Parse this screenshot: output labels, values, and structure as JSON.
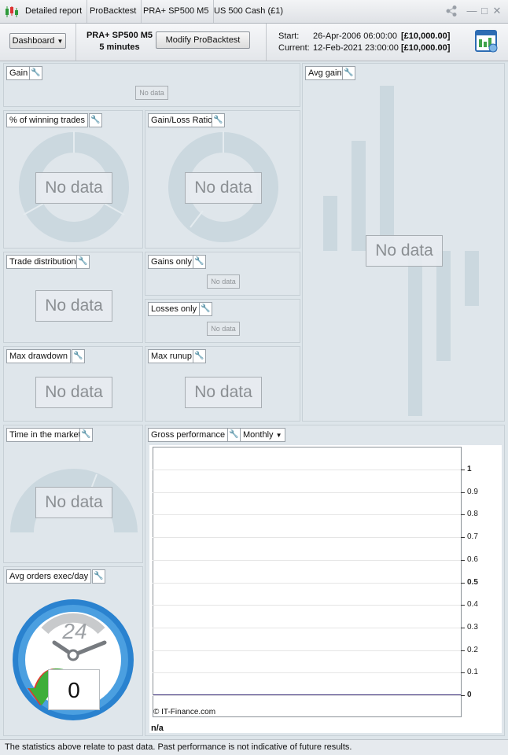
{
  "titlebar": {
    "tabs": [
      "Detailed report",
      "ProBacktest",
      "PRA+ SP500 M5",
      "US 500 Cash (£1)"
    ]
  },
  "header": {
    "dashboard_label": "Dashboard",
    "strategy_name": "PRA+ SP500 M5",
    "timeframe": "5 minutes",
    "modify_label": "Modify ProBacktest",
    "start_label": "Start:",
    "start_date": "26-Apr-2006 06:00:00",
    "start_value": "[£10,000.00]",
    "current_label": "Current:",
    "current_date": "12-Feb-2021 23:00:00",
    "current_value": "[£10,000.00]"
  },
  "panels": {
    "gain": "Gain",
    "avg_gain": "Avg gain",
    "winning_trades": "% of winning trades",
    "gain_loss_ratio": "Gain/Loss Ratio",
    "trade_distribution": "Trade distribution",
    "gains_only": "Gains only",
    "losses_only": "Losses only",
    "max_drawdown": "Max drawdown",
    "max_runup": "Max runup",
    "time_in_market": "Time in the market",
    "gross_performance": "Gross performance",
    "period_select": "Monthly",
    "avg_orders": "Avg orders exec/day"
  },
  "no_data": "No data",
  "clock": {
    "hours": "24",
    "count": "0"
  },
  "chart_data": {
    "type": "line",
    "title": "Gross performance",
    "y_ticks": [
      "1",
      "0.9",
      "0.8",
      "0.7",
      "0.6",
      "0.5",
      "0.4",
      "0.3",
      "0.2",
      "0.1",
      "0"
    ],
    "ylim": [
      0,
      1
    ],
    "x_label": "n/a",
    "series": [],
    "copyright": "© IT-Finance.com"
  },
  "footer": "The statistics above relate to past data. Past performance is not indicative of future results.",
  "colors": {
    "placeholder": "#cbd8df",
    "panel_bg": "#dfe6eb",
    "accent_blue": "#2a82cf"
  }
}
